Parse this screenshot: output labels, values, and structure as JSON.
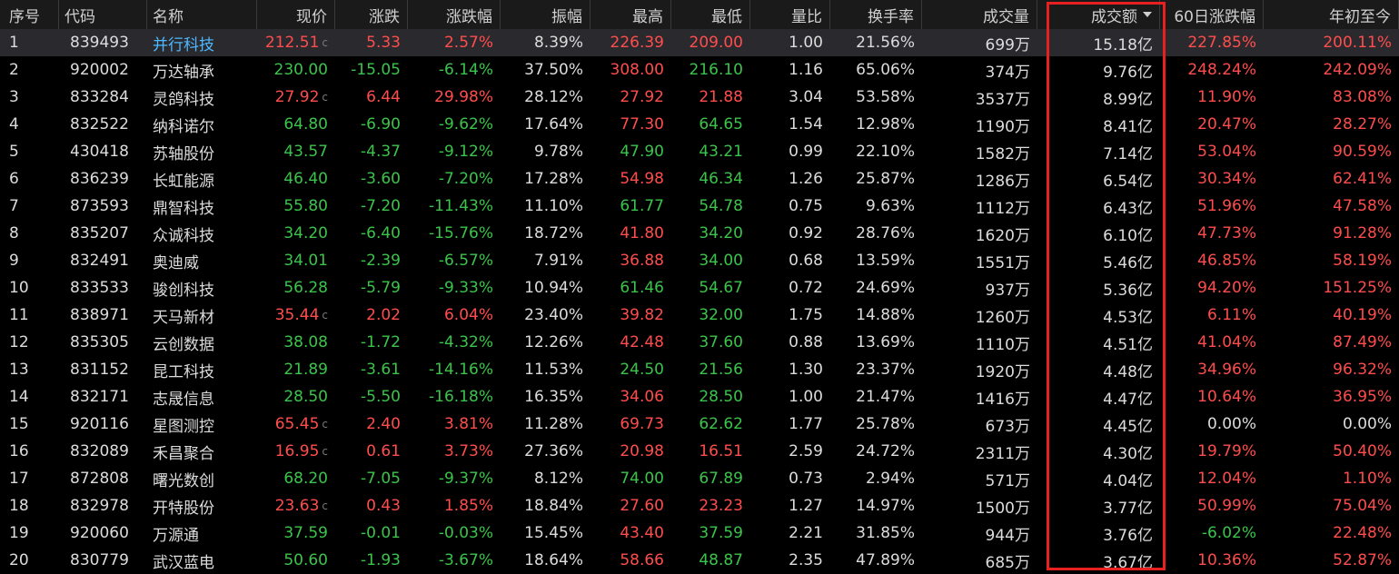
{
  "headers": [
    "序号",
    "代码",
    "名称",
    "现价",
    "涨跌",
    "涨跌幅",
    "振幅",
    "最高",
    "最低",
    "量比",
    "换手率",
    "成交量",
    "成交额",
    "60日涨跌幅",
    "年初至今"
  ],
  "sorted_column_index": 12,
  "price_marker": "c",
  "colors": {
    "up": "#ff4d4d",
    "down": "#3bc44b",
    "name_selected": "#4db8ff",
    "highlight": "#e8201f"
  },
  "rows": [
    {
      "n": "1",
      "code": "839493",
      "name": "并行科技",
      "price": "212.51",
      "chg": "5.33",
      "pct": "2.57%",
      "amp": "8.39%",
      "high": "226.39",
      "low": "209.00",
      "vr": "1.00",
      "turn": "21.56%",
      "vol": "699万",
      "amt": "15.18亿",
      "d60": "227.85%",
      "ytd": "200.11%"
    },
    {
      "n": "2",
      "code": "920002",
      "name": "万达轴承",
      "price": "230.00",
      "chg": "-15.05",
      "pct": "-6.14%",
      "amp": "37.50%",
      "high": "308.00",
      "low": "216.10",
      "vr": "1.16",
      "turn": "65.06%",
      "vol": "374万",
      "amt": "9.76亿",
      "d60": "248.24%",
      "ytd": "242.09%"
    },
    {
      "n": "3",
      "code": "833284",
      "name": "灵鸽科技",
      "price": "27.92",
      "chg": "6.44",
      "pct": "29.98%",
      "amp": "28.12%",
      "high": "27.92",
      "low": "21.88",
      "vr": "3.04",
      "turn": "53.58%",
      "vol": "3537万",
      "amt": "8.99亿",
      "d60": "11.90%",
      "ytd": "83.08%"
    },
    {
      "n": "4",
      "code": "832522",
      "name": "纳科诺尔",
      "price": "64.80",
      "chg": "-6.90",
      "pct": "-9.62%",
      "amp": "17.64%",
      "high": "77.30",
      "low": "64.65",
      "vr": "1.54",
      "turn": "12.98%",
      "vol": "1190万",
      "amt": "8.41亿",
      "d60": "20.47%",
      "ytd": "28.27%"
    },
    {
      "n": "5",
      "code": "430418",
      "name": "苏轴股份",
      "price": "43.57",
      "chg": "-4.37",
      "pct": "-9.12%",
      "amp": "9.78%",
      "high": "47.90",
      "low": "43.21",
      "vr": "0.99",
      "turn": "22.10%",
      "vol": "1582万",
      "amt": "7.14亿",
      "d60": "53.04%",
      "ytd": "90.59%"
    },
    {
      "n": "6",
      "code": "836239",
      "name": "长虹能源",
      "price": "46.40",
      "chg": "-3.60",
      "pct": "-7.20%",
      "amp": "17.28%",
      "high": "54.98",
      "low": "46.34",
      "vr": "1.26",
      "turn": "25.87%",
      "vol": "1286万",
      "amt": "6.54亿",
      "d60": "30.34%",
      "ytd": "62.41%"
    },
    {
      "n": "7",
      "code": "873593",
      "name": "鼎智科技",
      "price": "55.80",
      "chg": "-7.20",
      "pct": "-11.43%",
      "amp": "11.10%",
      "high": "61.77",
      "low": "54.78",
      "vr": "0.75",
      "turn": "9.63%",
      "vol": "1112万",
      "amt": "6.43亿",
      "d60": "51.96%",
      "ytd": "47.58%"
    },
    {
      "n": "8",
      "code": "835207",
      "name": "众诚科技",
      "price": "34.20",
      "chg": "-6.40",
      "pct": "-15.76%",
      "amp": "18.72%",
      "high": "41.80",
      "low": "34.20",
      "vr": "0.92",
      "turn": "28.76%",
      "vol": "1620万",
      "amt": "6.10亿",
      "d60": "47.73%",
      "ytd": "91.28%"
    },
    {
      "n": "9",
      "code": "832491",
      "name": "奥迪威",
      "price": "34.01",
      "chg": "-2.39",
      "pct": "-6.57%",
      "amp": "7.91%",
      "high": "36.88",
      "low": "34.00",
      "vr": "0.68",
      "turn": "13.59%",
      "vol": "1551万",
      "amt": "5.46亿",
      "d60": "46.85%",
      "ytd": "58.19%"
    },
    {
      "n": "10",
      "code": "833533",
      "name": "骏创科技",
      "price": "56.28",
      "chg": "-5.79",
      "pct": "-9.33%",
      "amp": "10.94%",
      "high": "61.46",
      "low": "54.67",
      "vr": "0.72",
      "turn": "24.69%",
      "vol": "937万",
      "amt": "5.36亿",
      "d60": "94.20%",
      "ytd": "151.25%"
    },
    {
      "n": "11",
      "code": "838971",
      "name": "天马新材",
      "price": "35.44",
      "chg": "2.02",
      "pct": "6.04%",
      "amp": "23.40%",
      "high": "39.82",
      "low": "32.00",
      "vr": "1.75",
      "turn": "14.88%",
      "vol": "1260万",
      "amt": "4.53亿",
      "d60": "6.11%",
      "ytd": "40.19%"
    },
    {
      "n": "12",
      "code": "835305",
      "name": "云创数据",
      "price": "38.08",
      "chg": "-1.72",
      "pct": "-4.32%",
      "amp": "12.26%",
      "high": "42.48",
      "low": "37.60",
      "vr": "0.88",
      "turn": "13.69%",
      "vol": "1110万",
      "amt": "4.51亿",
      "d60": "41.04%",
      "ytd": "87.49%"
    },
    {
      "n": "13",
      "code": "831152",
      "name": "昆工科技",
      "price": "21.89",
      "chg": "-3.61",
      "pct": "-14.16%",
      "amp": "11.53%",
      "high": "24.50",
      "low": "21.56",
      "vr": "1.30",
      "turn": "23.37%",
      "vol": "1920万",
      "amt": "4.48亿",
      "d60": "34.96%",
      "ytd": "96.32%"
    },
    {
      "n": "14",
      "code": "832171",
      "name": "志晟信息",
      "price": "28.50",
      "chg": "-5.50",
      "pct": "-16.18%",
      "amp": "16.35%",
      "high": "34.06",
      "low": "28.50",
      "vr": "1.00",
      "turn": "21.47%",
      "vol": "1416万",
      "amt": "4.47亿",
      "d60": "10.64%",
      "ytd": "36.95%"
    },
    {
      "n": "15",
      "code": "920116",
      "name": "星图测控",
      "price": "65.45",
      "chg": "2.40",
      "pct": "3.81%",
      "amp": "11.28%",
      "high": "69.73",
      "low": "62.62",
      "vr": "1.77",
      "turn": "25.78%",
      "vol": "673万",
      "amt": "4.45亿",
      "d60": "0.00%",
      "ytd": "0.00%"
    },
    {
      "n": "16",
      "code": "832089",
      "name": "禾昌聚合",
      "price": "16.95",
      "chg": "0.61",
      "pct": "3.73%",
      "amp": "27.36%",
      "high": "20.98",
      "low": "16.51",
      "vr": "2.59",
      "turn": "24.72%",
      "vol": "2311万",
      "amt": "4.30亿",
      "d60": "19.79%",
      "ytd": "50.40%"
    },
    {
      "n": "17",
      "code": "872808",
      "name": "曙光数创",
      "price": "68.20",
      "chg": "-7.05",
      "pct": "-9.37%",
      "amp": "8.12%",
      "high": "74.00",
      "low": "67.89",
      "vr": "0.73",
      "turn": "2.94%",
      "vol": "571万",
      "amt": "4.04亿",
      "d60": "12.04%",
      "ytd": "1.10%"
    },
    {
      "n": "18",
      "code": "832978",
      "name": "开特股份",
      "price": "23.63",
      "chg": "0.43",
      "pct": "1.85%",
      "amp": "18.84%",
      "high": "27.60",
      "low": "23.23",
      "vr": "1.27",
      "turn": "14.97%",
      "vol": "1500万",
      "amt": "3.77亿",
      "d60": "50.99%",
      "ytd": "75.04%"
    },
    {
      "n": "19",
      "code": "920060",
      "name": "万源通",
      "price": "37.59",
      "chg": "-0.01",
      "pct": "-0.03%",
      "amp": "15.45%",
      "high": "43.40",
      "low": "37.59",
      "vr": "2.21",
      "turn": "31.85%",
      "vol": "944万",
      "amt": "3.76亿",
      "d60": "-6.02%",
      "ytd": "22.48%"
    },
    {
      "n": "20",
      "code": "830779",
      "name": "武汉蓝电",
      "price": "50.60",
      "chg": "-1.93",
      "pct": "-3.67%",
      "amp": "18.64%",
      "high": "58.66",
      "low": "48.87",
      "vr": "2.35",
      "turn": "47.89%",
      "vol": "685万",
      "amt": "3.67亿",
      "d60": "10.36%",
      "ytd": "52.87%"
    }
  ],
  "selected_row": 0,
  "row_price_marker_rows": [
    0,
    2,
    10,
    14,
    15,
    17
  ]
}
